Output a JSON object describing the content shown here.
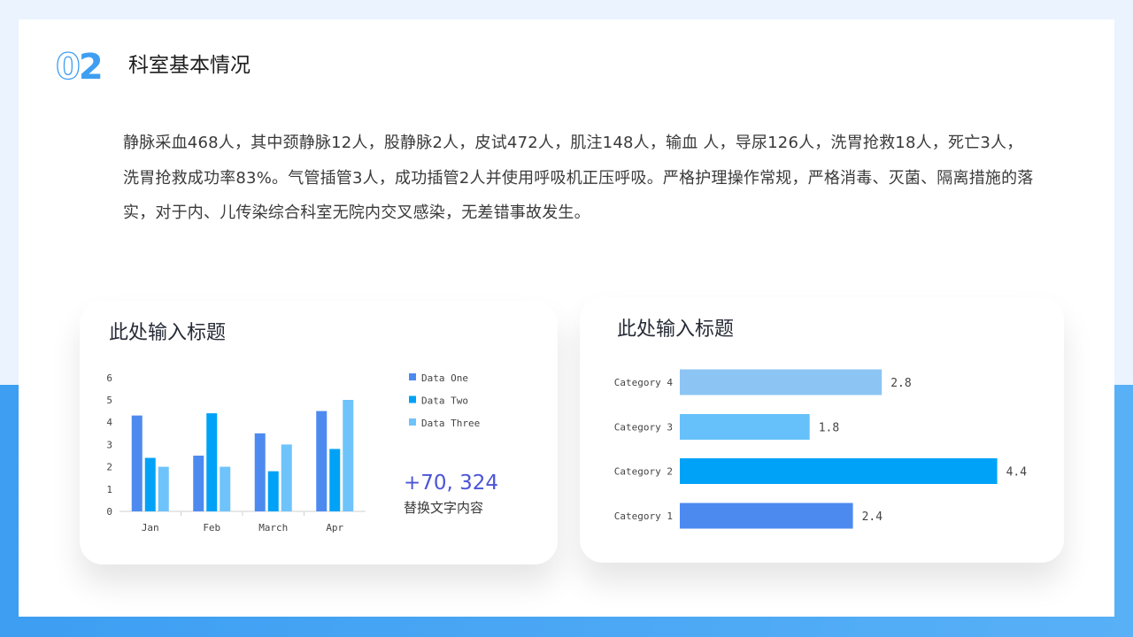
{
  "section": {
    "number_prefix": "0",
    "number_main": "2",
    "title": "科室基本情况"
  },
  "paragraph": "静脉采血468人，其中颈静脉12人，股静脉2人，皮试472人，肌注148人，输血 人，导尿126人，洗胃抢救18人，死亡3人，洗胃抢救成功率83%。气管插管3人，成功插管2人并使用呼吸机正压呼吸。严格护理操作常规，严格消毒、灭菌、隔离措施的落实，对于内、儿传染综合科室无院内交叉感染，无差错事故发生。",
  "card1": {
    "title": "此处输入标题",
    "stat_value": "+70, 324",
    "stat_label": "替换文字内容"
  },
  "card2": {
    "title": "此处输入标题"
  },
  "colors": {
    "accent": "#3d9ef2",
    "series1": "#4d8af0",
    "series2": "#00a2f7",
    "series3": "#6ec3fb",
    "bar_cat4": "#8cc5f3",
    "bar_cat3": "#66c1fb",
    "bar_cat2": "#00a2f7",
    "bar_cat1": "#4d8af0"
  },
  "chart_data": [
    {
      "type": "bar",
      "title": "",
      "categories": [
        "Jan",
        "Feb",
        "March",
        "Apr"
      ],
      "series": [
        {
          "name": "Data One",
          "values": [
            4.3,
            2.5,
            3.5,
            4.5
          ]
        },
        {
          "name": "Data Two",
          "values": [
            2.4,
            4.4,
            1.8,
            2.8
          ]
        },
        {
          "name": "Data Three",
          "values": [
            2.0,
            2.0,
            3.0,
            5.0
          ]
        }
      ],
      "ylim": [
        0,
        6
      ],
      "yticks": [
        "0",
        "1",
        "2",
        "3",
        "4",
        "5",
        "6"
      ],
      "legend": "right",
      "grid": false
    },
    {
      "type": "bar",
      "orientation": "horizontal",
      "title": "",
      "categories": [
        "Category 4",
        "Category 3",
        "Category 2",
        "Category 1"
      ],
      "values": [
        2.8,
        1.8,
        4.4,
        2.4
      ],
      "value_labels": [
        "2.8",
        "1.8",
        "4.4",
        "2.4"
      ],
      "grid": false
    }
  ]
}
